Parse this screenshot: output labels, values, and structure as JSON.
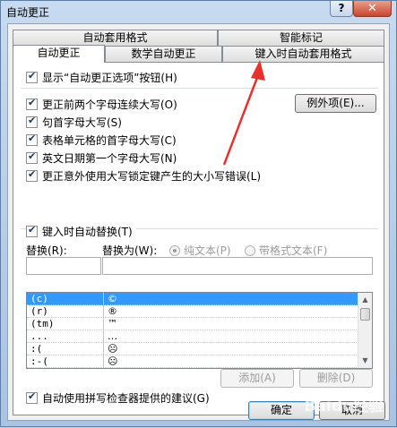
{
  "window": {
    "title": "自动更正"
  },
  "titlebar": {
    "help_glyph": "?",
    "close_glyph": "✕"
  },
  "tabs_row1": [
    {
      "label": "自动套用格式"
    },
    {
      "label": "智能标记"
    }
  ],
  "tabs_row2": [
    {
      "label": "自动更正",
      "active": true
    },
    {
      "label": "数学自动更正"
    },
    {
      "label": "键入时自动套用格式"
    }
  ],
  "options": {
    "show_buttons": "显示“自动更正选项”按钮(H)",
    "items": [
      {
        "label": "更正前两个字母连续大写(O)",
        "checked": true
      },
      {
        "label": "句首字母大写(S)",
        "checked": true
      },
      {
        "label": "表格单元格的首字母大写(C)",
        "checked": true
      },
      {
        "label": "英文日期第一个字母大写(N)",
        "checked": true
      },
      {
        "label": "更正意外使用大写锁定键产生的大小写错误(L)",
        "checked": true
      }
    ],
    "exceptions_button": "例外项(E)..."
  },
  "replace_section": {
    "checkbox": "键入时自动替换(T)",
    "replace_label": "替换(R):",
    "with_label": "替换为(W):",
    "plain_text": "纯文本(P)",
    "formatted_text": "带格式文本(F)",
    "replace_value": "",
    "with_value": ""
  },
  "list": {
    "rows": [
      {
        "from": "(c)",
        "to": "©",
        "selected": true
      },
      {
        "from": "(r)",
        "to": "®"
      },
      {
        "from": "(tm)",
        "to": "™"
      },
      {
        "from": "...",
        "to": "…"
      },
      {
        "from": ":(",
        "to": "☹"
      },
      {
        "from": ":-(",
        "to": "☹"
      }
    ]
  },
  "buttons": {
    "add": "添加(A)",
    "delete": "删除(D)",
    "ok": "确定",
    "cancel": "取消"
  },
  "spell_suggest": "自动使用拼写检查器提供的建议(G)",
  "watermark": "Baidu经验",
  "colors": {
    "selection": "#3399ff",
    "annotation_arrow": "#e8312a"
  }
}
